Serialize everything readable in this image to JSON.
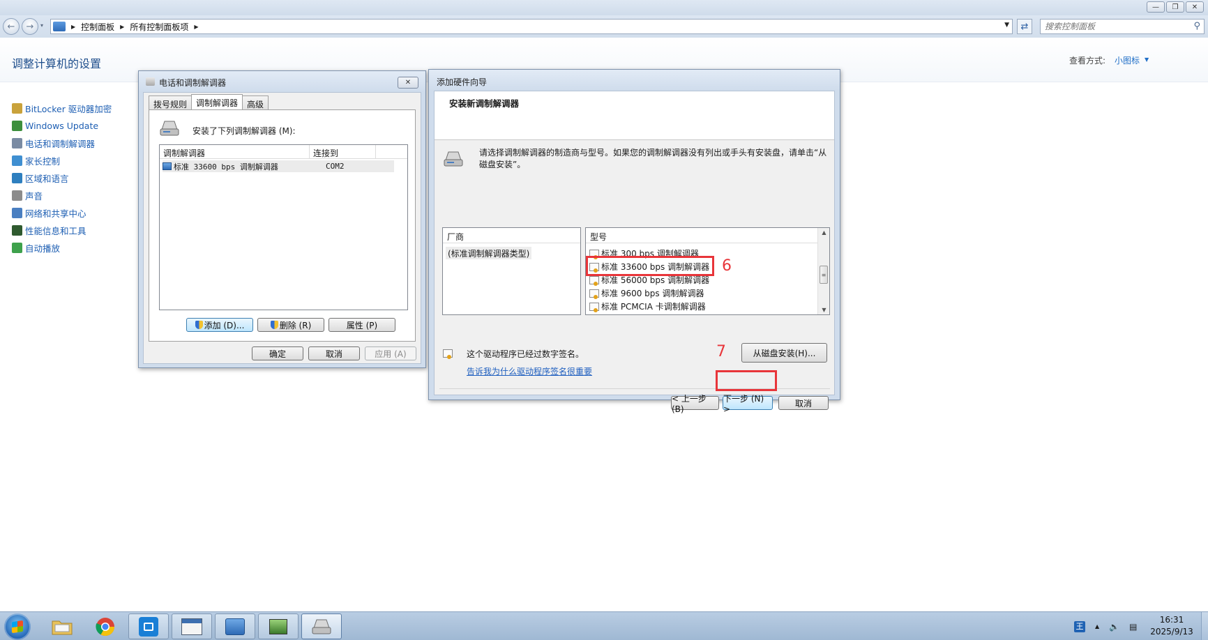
{
  "explorer": {
    "breadcrumbs": [
      "控制面板",
      "所有控制面板项"
    ],
    "search_placeholder": "搜索控制面板",
    "page_title": "调整计算机的设置",
    "view_by_label": "查看方式:",
    "view_by_value": "小图标"
  },
  "cp_items": [
    {
      "label": "BitLocker 驱动器加密",
      "color": "#c9a23b"
    },
    {
      "label": "Windows Update",
      "color": "#3d8f3d"
    },
    {
      "label": "电话和调制解调器",
      "color": "#7a8ba3"
    },
    {
      "label": "家长控制",
      "color": "#3f8fd1"
    },
    {
      "label": "区域和语言",
      "color": "#2e7fbf"
    },
    {
      "label": "声音",
      "color": "#8c8c8c"
    },
    {
      "label": "网络和共享中心",
      "color": "#4a7fc1"
    },
    {
      "label": "性能信息和工具",
      "color": "#2f5a2f"
    },
    {
      "label": "自动播放",
      "color": "#3ea14c"
    }
  ],
  "phone_modem_dialog": {
    "title": "电话和调制解调器",
    "tabs": [
      "拨号规则",
      "调制解调器",
      "高级"
    ],
    "active_tab": "调制解调器",
    "installed_label": "安装了下列调制解调器 (M):",
    "columns": [
      "调制解调器",
      "连接到"
    ],
    "rows": [
      {
        "modem": "标准 33600 bps 调制解调器",
        "port": "COM2"
      }
    ],
    "add_button": "添加 (D)...",
    "remove_button": "删除 (R)",
    "properties_button": "属性 (P)",
    "ok_button": "确定",
    "cancel_button": "取消",
    "apply_button": "应用 (A)"
  },
  "wizard": {
    "title": "添加硬件向导",
    "heading": "安装新调制解调器",
    "description": "请选择调制解调器的制造商与型号。如果您的调制解调器没有列出或手头有安装盘，请单击“从磁盘安装”。",
    "manufacturer_header": "厂商",
    "manufacturers": [
      "(标准调制解调器类型)"
    ],
    "model_header": "型号",
    "models": [
      "标准 300 bps 调制解调器",
      "标准 33600 bps 调制解调器",
      "标准 56000 bps 调制解调器",
      "标准 9600 bps 调制解调器",
      "标准 PCMCIA 卡调制解调器"
    ],
    "selected_model": "标准 33600 bps 调制解调器",
    "signed_text": "这个驱动程序已经过数字签名。",
    "signing_link": "告诉我为什么驱动程序签名很重要",
    "have_disk_button": "从磁盘安装(H)...",
    "back_button": "< 上一步 (B)",
    "next_button": "下一步 (N) >",
    "cancel_button": "取消"
  },
  "annotations": {
    "step6": "6",
    "step7": "7",
    "color": "#e8353a"
  },
  "taskbar": {
    "apps": [
      "start-orb",
      "file-explorer",
      "chrome",
      "store",
      "window-app",
      "control-panel",
      "network-app",
      "phone-modem"
    ],
    "ime": "王",
    "time": "16:31",
    "date": "2025/9/13"
  }
}
